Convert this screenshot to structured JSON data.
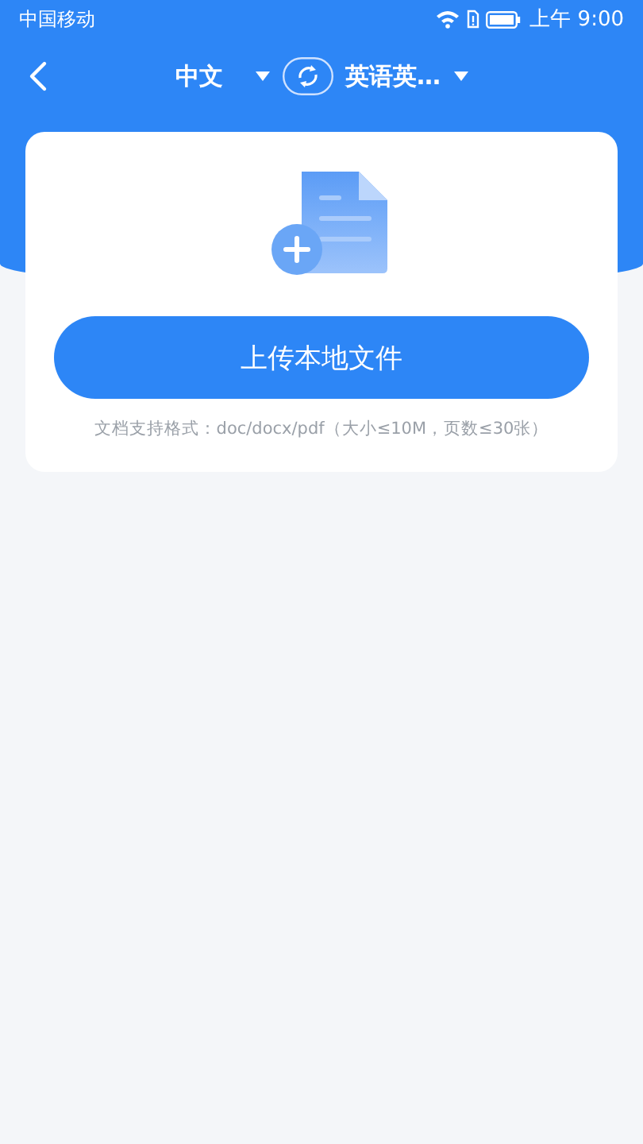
{
  "status_bar": {
    "carrier": "中国移动",
    "time": "上午 9:00"
  },
  "nav": {
    "source_language": "中文",
    "target_language": "英语英…"
  },
  "upload": {
    "button": "上传本地文件",
    "hint": "文档支持格式：doc/docx/pdf（大小≤10M，页数≤30张）"
  }
}
